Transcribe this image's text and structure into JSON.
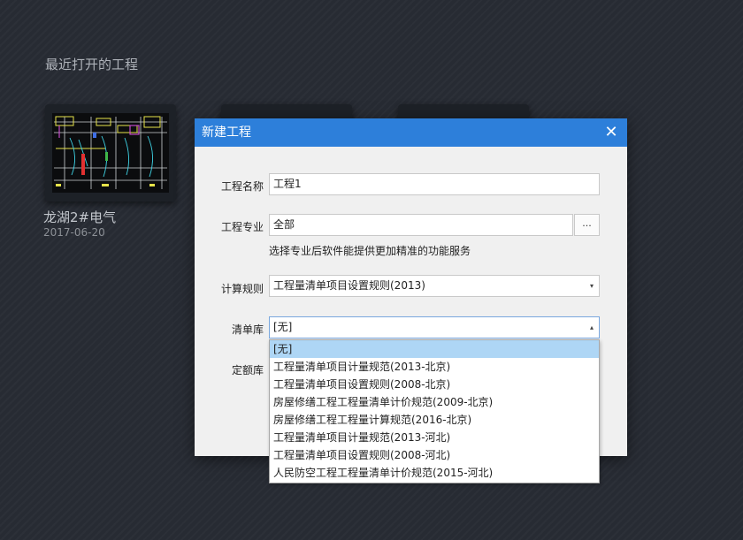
{
  "recent": {
    "title": "最近打开的工程",
    "project": {
      "name": "龙湖2#电气",
      "date": "2017-06-20"
    }
  },
  "dialog": {
    "title": "新建工程",
    "close_icon": "✕",
    "fields": {
      "name": {
        "label": "工程名称",
        "value": "工程1"
      },
      "specialty": {
        "label": "工程专业",
        "value": "全部",
        "browse_label": "...",
        "hint": "选择专业后软件能提供更加精准的功能服务"
      },
      "calc_rule": {
        "label": "计算规则",
        "value": "工程量清单项目设置规则(2013)"
      },
      "bill_lib": {
        "label": "清单库",
        "value": "[无]"
      },
      "quota_lib": {
        "label": "定额库"
      }
    },
    "dropdown": {
      "items": [
        "[无]",
        "工程量清单项目计量规范(2013-北京)",
        "工程量清单项目设置规则(2008-北京)",
        "房屋修缮工程工程量清单计价规范(2009-北京)",
        "房屋修缮工程工程量计算规范(2016-北京)",
        "工程量清单项目计量规范(2013-河北)",
        "工程量清单项目设置规则(2008-河北)",
        "人民防空工程工程量清单计价规范(2015-河北)"
      ],
      "selected_index": 0
    }
  },
  "icons": {
    "dropdown_arrow": "▾",
    "dropdown_arrow_up": "▴"
  }
}
